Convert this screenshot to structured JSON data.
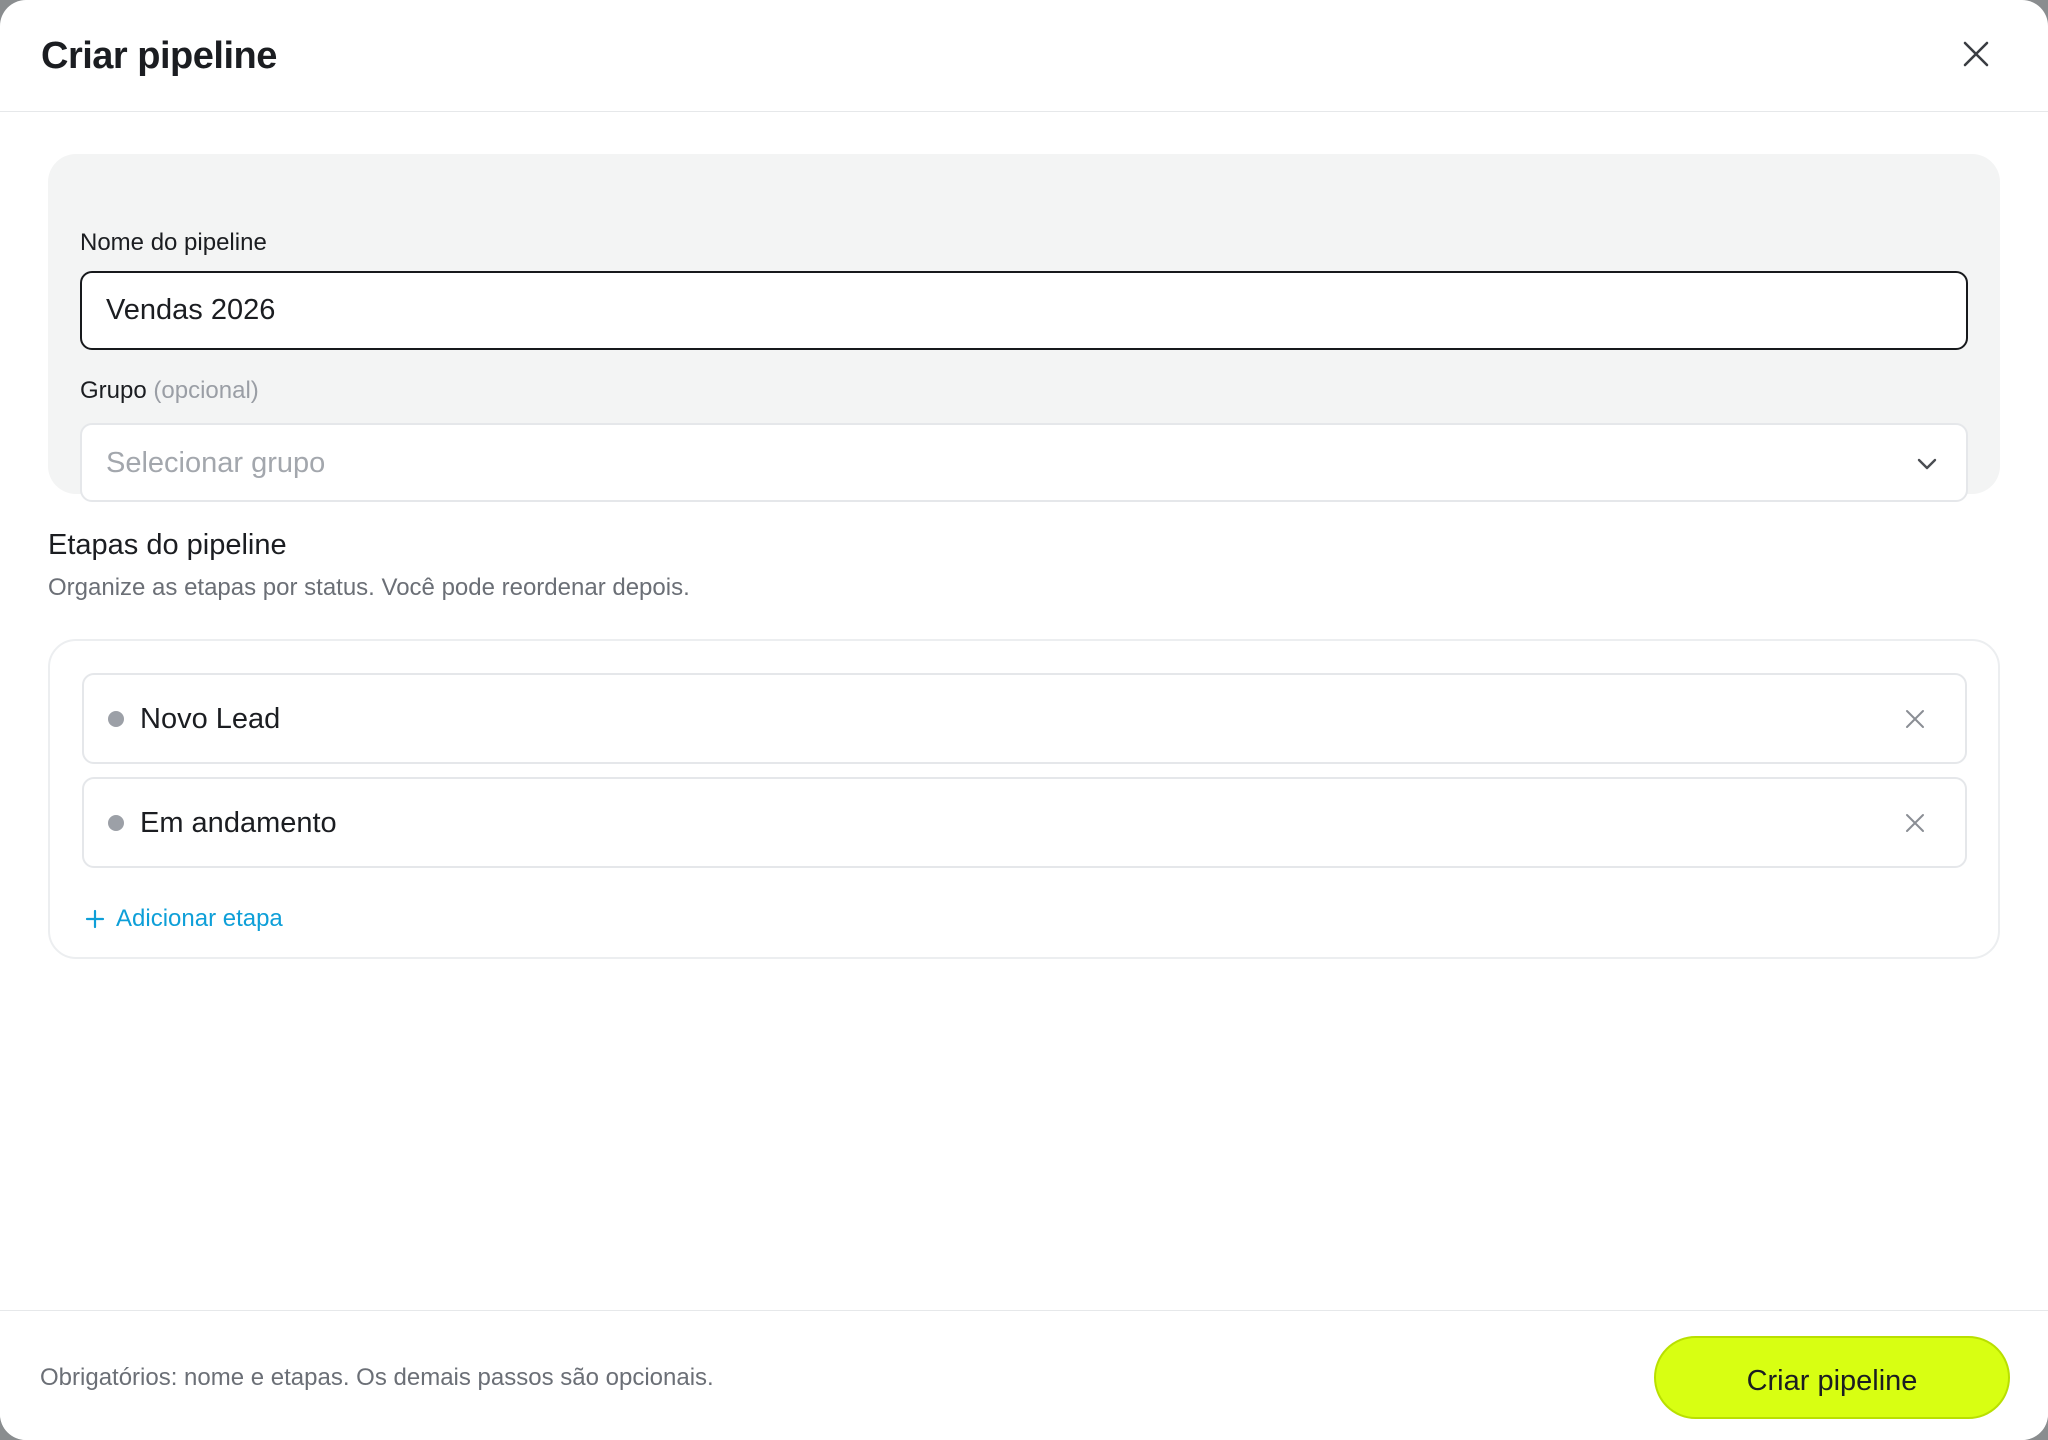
{
  "modal": {
    "title": "Criar pipeline"
  },
  "form": {
    "name_label": "Nome do pipeline",
    "name_value": "Vendas 2026",
    "group_label": "Grupo",
    "group_optional": "(opcional)",
    "group_placeholder": "Selecionar grupo"
  },
  "stages": {
    "title": "Etapas do pipeline",
    "subtitle": "Organize as etapas por status. Você pode reordenar depois.",
    "items": [
      {
        "name": "Novo Lead"
      },
      {
        "name": "Em andamento"
      }
    ],
    "add_label": "Adicionar etapa"
  },
  "footer": {
    "note": "Obrigatórios: nome e etapas. Os demais passos são opcionais.",
    "submit_label": "Criar pipeline"
  },
  "colors": {
    "primary": "#d8ff12",
    "link": "#0e9fd8",
    "text": "#1b1d21",
    "muted": "#6b6f76"
  },
  "icons": {
    "close": "close-icon",
    "chevron": "chevron-down-icon",
    "stage_dot": "status-dot-icon",
    "remove": "remove-icon",
    "add": "plus-icon"
  }
}
